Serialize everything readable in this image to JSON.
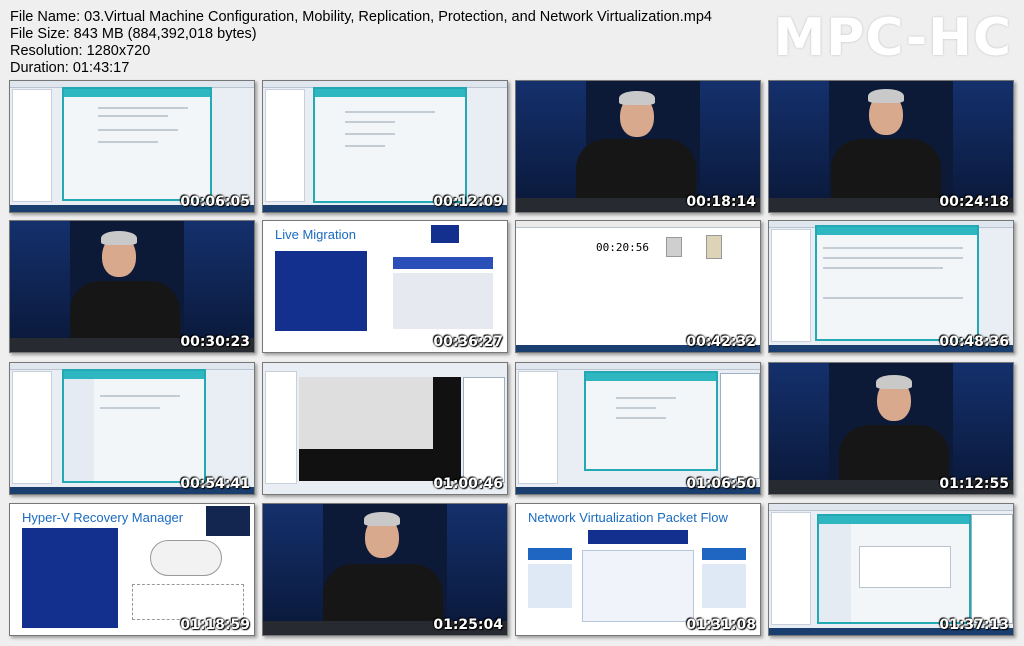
{
  "header": {
    "file_name": "File Name: 03.Virtual Machine Configuration, Mobility, Replication, Protection, and Network Virtualization.mp4",
    "file_size": "File Size: 843 MB (884,392,018 bytes)",
    "resolution": "Resolution: 1280x720",
    "duration": "Duration: 01:43:17"
  },
  "logo": "MPC-HC",
  "thumbnails": [
    {
      "time": "00:06:05",
      "kind": "desktop"
    },
    {
      "time": "00:12:09",
      "kind": "desktop"
    },
    {
      "time": "00:18:14",
      "kind": "video"
    },
    {
      "time": "00:24:18",
      "kind": "video"
    },
    {
      "time": "00:30:23",
      "kind": "video"
    },
    {
      "time": "00:36:27",
      "kind": "slide",
      "title": "Live Migration"
    },
    {
      "time": "00:42:32",
      "kind": "desktop",
      "clock": "00:20:56"
    },
    {
      "time": "00:48:36",
      "kind": "desktop"
    },
    {
      "time": "00:54:41",
      "kind": "desktop"
    },
    {
      "time": "01:00:46",
      "kind": "desktop"
    },
    {
      "time": "01:06:50",
      "kind": "desktop"
    },
    {
      "time": "01:12:55",
      "kind": "video"
    },
    {
      "time": "01:18:59",
      "kind": "slide",
      "title": "Hyper-V Recovery Manager"
    },
    {
      "time": "01:25:04",
      "kind": "video"
    },
    {
      "time": "01:31:08",
      "kind": "slide",
      "title": "Network Virtualization Packet Flow"
    },
    {
      "time": "01:37:13",
      "kind": "desktop"
    }
  ]
}
